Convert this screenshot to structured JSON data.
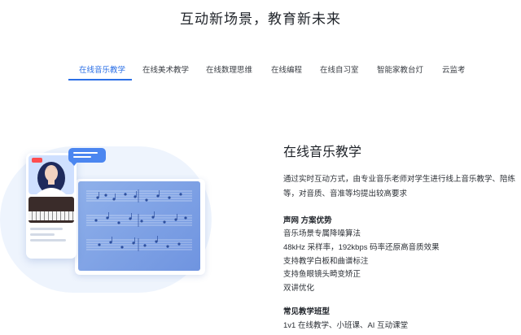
{
  "headline": "互动新场景，教育新未来",
  "tabs": [
    {
      "label": "在线音乐教学",
      "active": true
    },
    {
      "label": "在线美术教学",
      "active": false
    },
    {
      "label": "在线数理思维",
      "active": false
    },
    {
      "label": "在线编程",
      "active": false
    },
    {
      "label": "在线自习室",
      "active": false
    },
    {
      "label": "智能家教台灯",
      "active": false
    },
    {
      "label": "云监考",
      "active": false
    }
  ],
  "accent_color": "#2b6fe6",
  "panel": {
    "title": "在线音乐教学",
    "description": "通过实时互动方式，由专业音乐老师对学生进行线上音乐教学、陪练等，对音质、音准等均提出较高要求",
    "advantages": {
      "title": "声网 方案优势",
      "items": [
        "音乐场景专属降噪算法",
        "48kHz 采样率，192kbps 码率还原高音质效果",
        "支持教学白板和曲谱标注",
        "支持鱼眼镜头畸变矫正",
        "双讲优化"
      ]
    },
    "classes": {
      "title": "常见教学班型",
      "items": [
        "1v1 在线教学、小班课、AI 互动课堂"
      ]
    }
  },
  "illustration": {
    "icons": [
      "teacher-avatar-icon",
      "piano-icon",
      "sheet-music-icon",
      "chat-bubble-icon"
    ]
  }
}
